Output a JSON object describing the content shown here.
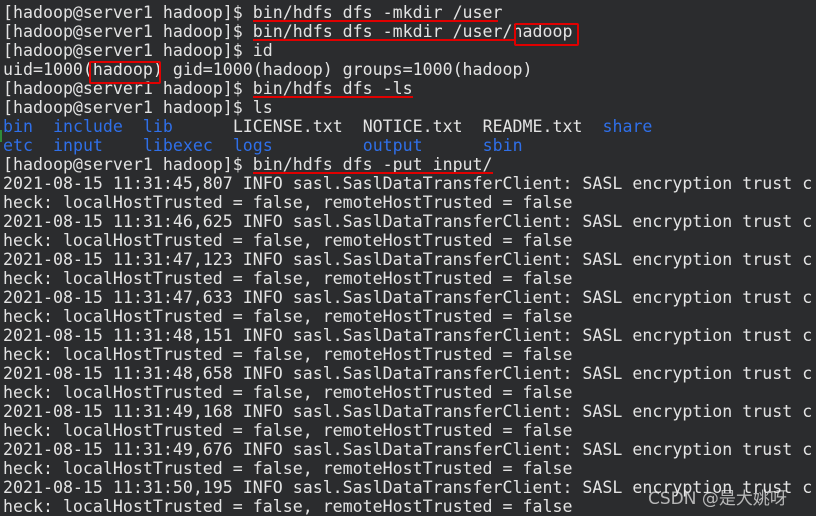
{
  "terminal": {
    "colors": {
      "background": "#2b2c2e",
      "text": "#e3e3e3",
      "directory": "#2f6fe8",
      "annotation": "#e00000"
    },
    "lines": [
      [
        [
          "[hadoop@server1 hadoop]$ ",
          ""
        ],
        [
          "bin/hdfs dfs -mkdir /user",
          ""
        ]
      ],
      [
        [
          "[hadoop@server1 hadoop]$ ",
          ""
        ],
        [
          "bin/hdfs dfs -mkdir /user/hadoop",
          ""
        ]
      ],
      [
        [
          "[hadoop@server1 hadoop]$ ",
          ""
        ],
        [
          "id",
          ""
        ]
      ],
      [
        [
          "uid=1000(hadoop) gid=1000(hadoop) groups=1000(hadoop)",
          ""
        ]
      ],
      [
        [
          "[hadoop@server1 hadoop]$ ",
          ""
        ],
        [
          "bin/hdfs dfs -ls",
          ""
        ]
      ],
      [
        [
          "[hadoop@server1 hadoop]$ ",
          ""
        ],
        [
          "ls",
          ""
        ]
      ],
      [
        [
          "bin",
          "blue"
        ],
        [
          "  ",
          ""
        ],
        [
          "include",
          "blue"
        ],
        [
          "  ",
          ""
        ],
        [
          "lib",
          "blue"
        ],
        [
          "      LICENSE.txt  NOTICE.txt  README.txt  ",
          ""
        ],
        [
          "share",
          "blue"
        ]
      ],
      [
        [
          "etc",
          "blue"
        ],
        [
          "  ",
          ""
        ],
        [
          "input",
          "blue"
        ],
        [
          "    ",
          ""
        ],
        [
          "libexec",
          "blue"
        ],
        [
          "  ",
          ""
        ],
        [
          "logs",
          "blue"
        ],
        [
          "         ",
          ""
        ],
        [
          "output",
          "blue"
        ],
        [
          "      ",
          ""
        ],
        [
          "sbin",
          "blue"
        ]
      ],
      [
        [
          "[hadoop@server1 hadoop]$ ",
          ""
        ],
        [
          "bin/hdfs dfs -put input/",
          ""
        ]
      ],
      [
        [
          "2021-08-15 11:31:45,807 INFO sasl.SaslDataTransferClient: SASL encryption trust c",
          ""
        ]
      ],
      [
        [
          "heck: localHostTrusted = false, remoteHostTrusted = false",
          ""
        ]
      ],
      [
        [
          "2021-08-15 11:31:46,625 INFO sasl.SaslDataTransferClient: SASL encryption trust c",
          ""
        ]
      ],
      [
        [
          "heck: localHostTrusted = false, remoteHostTrusted = false",
          ""
        ]
      ],
      [
        [
          "2021-08-15 11:31:47,123 INFO sasl.SaslDataTransferClient: SASL encryption trust c",
          ""
        ]
      ],
      [
        [
          "heck: localHostTrusted = false, remoteHostTrusted = false",
          ""
        ]
      ],
      [
        [
          "2021-08-15 11:31:47,633 INFO sasl.SaslDataTransferClient: SASL encryption trust c",
          ""
        ]
      ],
      [
        [
          "heck: localHostTrusted = false, remoteHostTrusted = false",
          ""
        ]
      ],
      [
        [
          "2021-08-15 11:31:48,151 INFO sasl.SaslDataTransferClient: SASL encryption trust c",
          ""
        ]
      ],
      [
        [
          "heck: localHostTrusted = false, remoteHostTrusted = false",
          ""
        ]
      ],
      [
        [
          "2021-08-15 11:31:48,658 INFO sasl.SaslDataTransferClient: SASL encryption trust c",
          ""
        ]
      ],
      [
        [
          "heck: localHostTrusted = false, remoteHostTrusted = false",
          ""
        ]
      ],
      [
        [
          "2021-08-15 11:31:49,168 INFO sasl.SaslDataTransferClient: SASL encryption trust c",
          ""
        ]
      ],
      [
        [
          "heck: localHostTrusted = false, remoteHostTrusted = false",
          ""
        ]
      ],
      [
        [
          "2021-08-15 11:31:49,676 INFO sasl.SaslDataTransferClient: SASL encryption trust c",
          ""
        ]
      ],
      [
        [
          "heck: localHostTrusted = false, remoteHostTrusted = false",
          ""
        ]
      ],
      [
        [
          "2021-08-15 11:31:50,195 INFO sasl.SaslDataTransferClient: SASL encryption trust c",
          ""
        ]
      ],
      [
        [
          "heck: localHostTrusted = false, remoteHostTrusted = false",
          ""
        ]
      ]
    ]
  },
  "watermark": "CSDN @是大姚呀"
}
